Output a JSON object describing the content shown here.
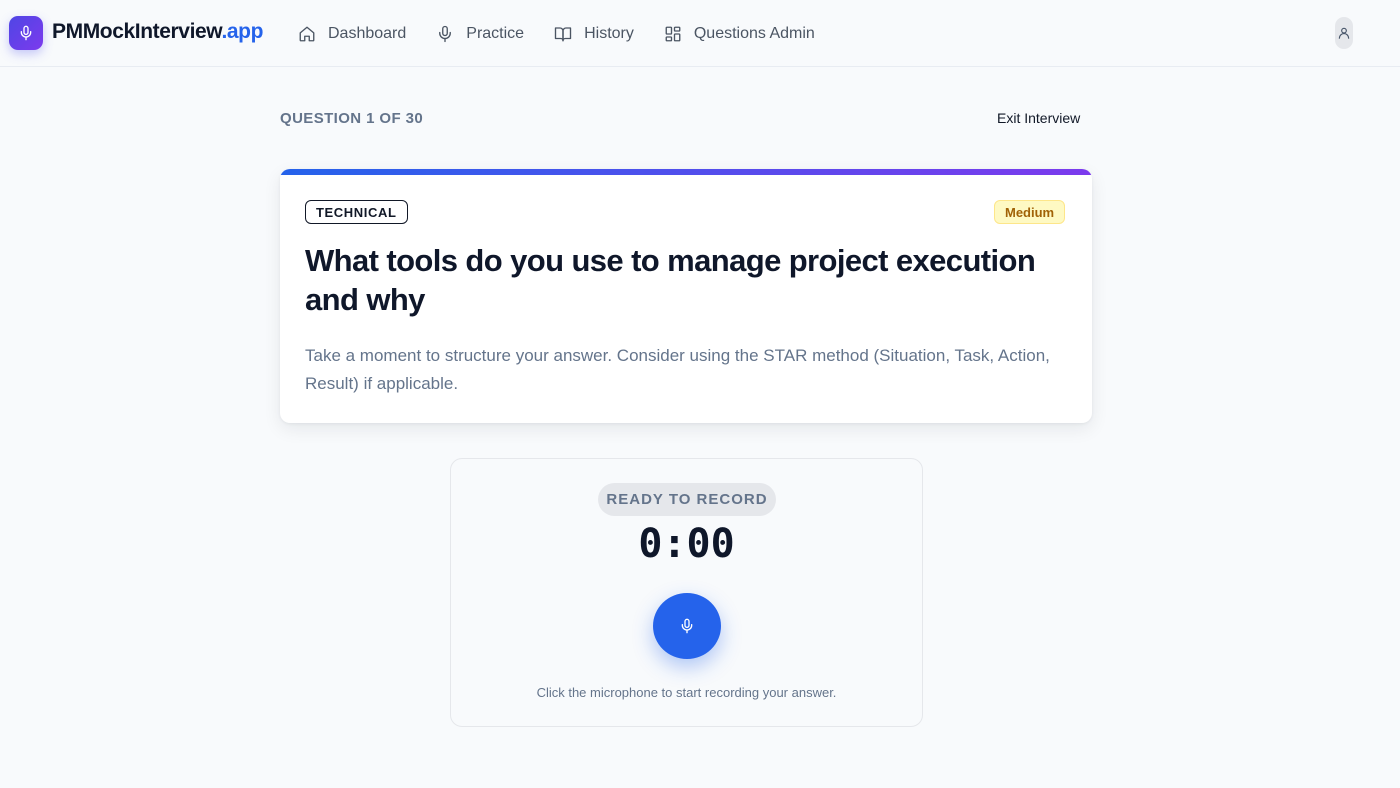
{
  "header": {
    "brand_main": "PMMockInterview",
    "brand_accent": ".app",
    "nav": [
      {
        "label": "Dashboard",
        "icon": "home-icon"
      },
      {
        "label": "Practice",
        "icon": "microphone-icon"
      },
      {
        "label": "History",
        "icon": "book-icon"
      },
      {
        "label": "Questions Admin",
        "icon": "grid-icon"
      }
    ],
    "avatar_icon": "user-icon"
  },
  "interview": {
    "progress_label": "QUESTION 1 OF 30",
    "exit_label": "Exit Interview"
  },
  "question": {
    "category": "TECHNICAL",
    "difficulty": "Medium",
    "title": "What tools do you use to manage project execution and why",
    "hint": "Take a moment to structure your answer. Consider using the STAR method (Situation, Task, Action, Result) if applicable."
  },
  "recorder": {
    "status": "READY TO RECORD",
    "timer": "0:00",
    "button_icon": "microphone-icon",
    "instruction": "Click the microphone to start recording your answer."
  },
  "colors": {
    "primary": "#2563eb",
    "gradient_end": "#7c3aed",
    "medium_bg": "#fef9c3",
    "medium_text": "#a16207"
  }
}
